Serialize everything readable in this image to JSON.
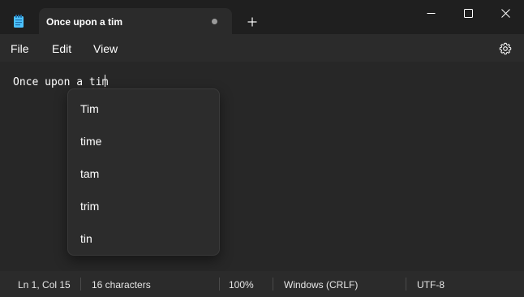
{
  "titlebar": {
    "tab_title": "Once upon a tim",
    "new_tab_symbol": "+",
    "icons": {
      "app": "notepad-icon",
      "unsaved": "unsaved-dot-icon",
      "new_tab": "plus-icon",
      "minimize": "minimize-icon",
      "maximize": "maximize-icon",
      "close": "close-icon"
    }
  },
  "menu": {
    "file": "File",
    "edit": "Edit",
    "view": "View",
    "settings_icon": "gear-icon"
  },
  "editor": {
    "text_before": "Once upon a ",
    "misspelled_word": "tim"
  },
  "suggestions": [
    "Tim",
    "time",
    "tam",
    "trim",
    "tin"
  ],
  "status": {
    "position": "Ln 1, Col 15",
    "characters": "16 characters",
    "zoom": "100%",
    "line_ending": "Windows (CRLF)",
    "encoding": "UTF-8"
  },
  "colors": {
    "background": "#272727",
    "titlebar": "#1f1f1f",
    "accent_icon": "#4cc2ff",
    "spellcheck_underline": "#e04a4a"
  }
}
